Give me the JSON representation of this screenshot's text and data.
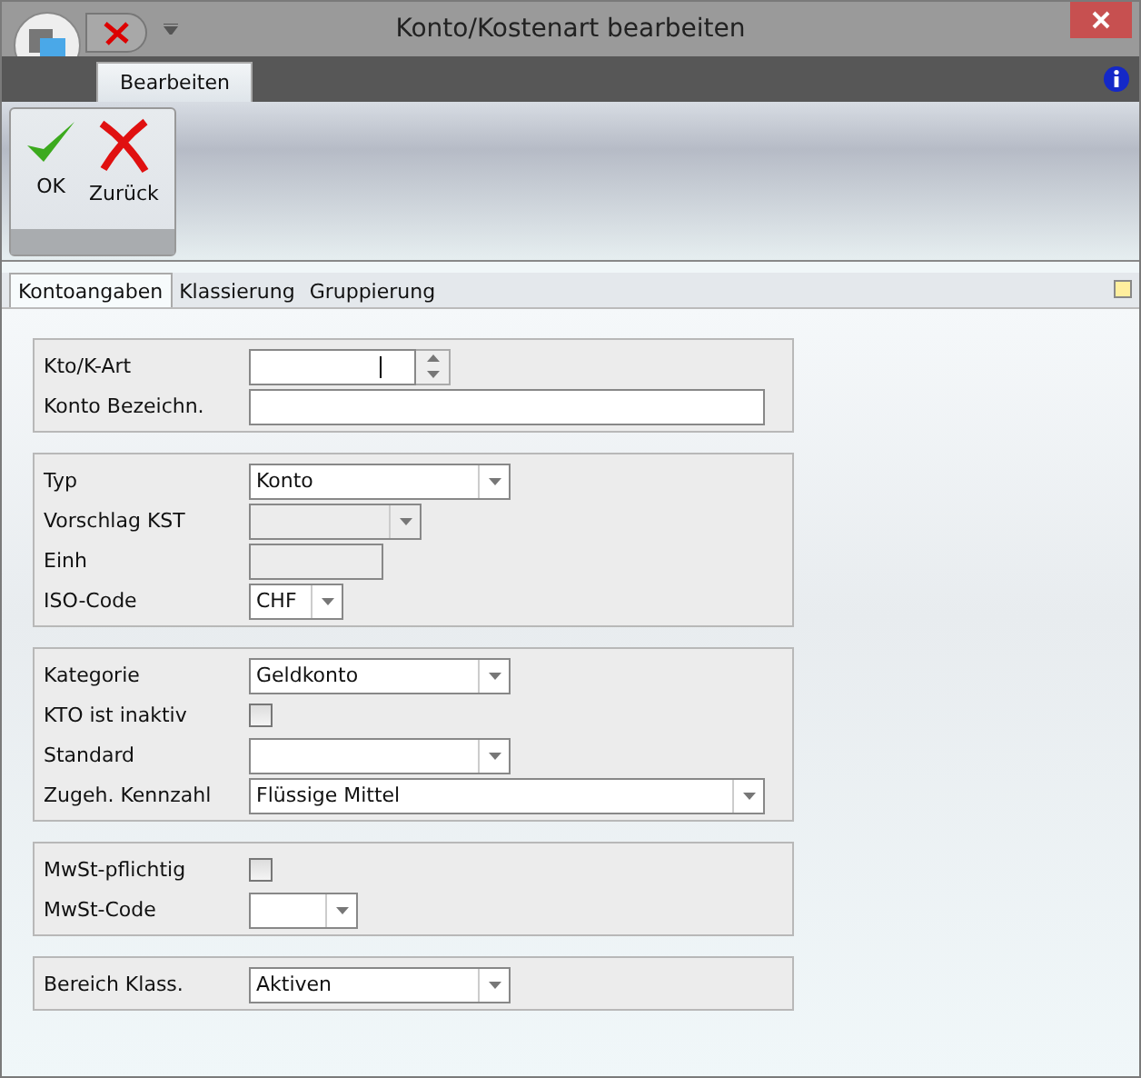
{
  "window": {
    "title": "Konto/Kostenart bearbeiten"
  },
  "ribbon_tabs": [
    {
      "label": "Bearbeiten",
      "selected": true
    }
  ],
  "ribbon_buttons": [
    {
      "label": "OK",
      "kind": "ok"
    },
    {
      "label": "Zurück",
      "kind": "back"
    }
  ],
  "tabs": [
    {
      "label": "Kontoangaben",
      "selected": true
    },
    {
      "label": "Klassierung",
      "selected": false
    },
    {
      "label": "Gruppierung",
      "selected": false
    }
  ],
  "groups": [
    {
      "fields": [
        {
          "label": "Kto/K-Art",
          "kind": "spin",
          "disabled": false
        },
        {
          "label": "Konto Bezeichn.",
          "kind": "text",
          "disabled": false
        }
      ]
    },
    {
      "fields": [
        {
          "label": "Typ",
          "kind": "combo",
          "value": "Konto",
          "disabled": false
        },
        {
          "label": "Vorschlag KST",
          "kind": "combo",
          "disabled": true
        },
        {
          "label": "Einh",
          "kind": "text",
          "disabled": true
        },
        {
          "label": "ISO-Code",
          "kind": "combo",
          "value": "CHF",
          "disabled": false
        }
      ]
    },
    {
      "fields": [
        {
          "label": "Kategorie",
          "kind": "combo",
          "value": "Geldkonto",
          "disabled": false
        },
        {
          "label": "KTO ist inaktiv",
          "kind": "checkbox",
          "checked": false
        },
        {
          "label": "Standard",
          "kind": "combo",
          "disabled": false
        },
        {
          "label": "Zugeh. Kennzahl",
          "kind": "combo",
          "value": "Flüssige Mittel",
          "disabled": false
        }
      ]
    },
    {
      "fields": [
        {
          "label": "MwSt-pflichtig",
          "kind": "checkbox",
          "checked": false
        },
        {
          "label": "MwSt-Code",
          "kind": "combo",
          "disabled": false
        }
      ]
    },
    {
      "fields": [
        {
          "label": "Bereich Klass.",
          "kind": "combo",
          "value": "Aktiven",
          "disabled": false
        }
      ]
    }
  ]
}
